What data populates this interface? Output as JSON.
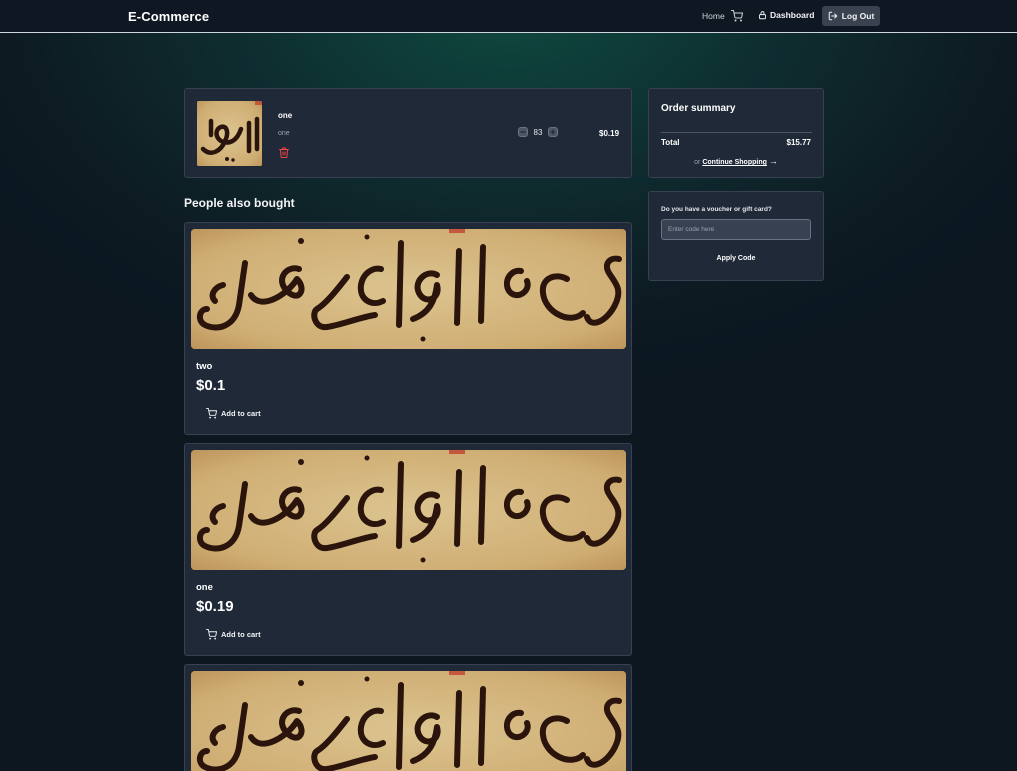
{
  "header": {
    "brand": "E-Commerce",
    "nav": {
      "home": "Home",
      "dashboard": "Dashboard",
      "logout": "Log Out"
    }
  },
  "cart": {
    "items": [
      {
        "title": "one",
        "description": "one",
        "quantity": "83",
        "price": "$0.19"
      }
    ]
  },
  "recommendations": {
    "title": "People also bought",
    "products": [
      {
        "name": "two",
        "price": "$0.1",
        "add_label": "Add to cart"
      },
      {
        "name": "one",
        "price": "$0.19",
        "add_label": "Add to cart"
      },
      {
        "name": "",
        "price": "",
        "add_label": ""
      }
    ]
  },
  "summary": {
    "title": "Order summary",
    "total_label": "Total",
    "total_value": "$15.77",
    "or_text": "or",
    "continue_label": "Continue Shopping",
    "arrow": "→"
  },
  "voucher": {
    "label": "Do you have a voucher or gift card?",
    "placeholder": "Enter code here",
    "apply_label": "Apply Code"
  },
  "icons": {
    "cart": "shopping-cart-icon",
    "lock": "lock-icon",
    "logout": "logout-icon",
    "trash": "trash-icon",
    "minus": "minus-icon",
    "plus": "plus-icon"
  },
  "colors": {
    "header_bg": "#0f1722",
    "panel_bg": "#1f2937",
    "delete_red": "#ef4444",
    "logout_bg": "#3a4250"
  }
}
